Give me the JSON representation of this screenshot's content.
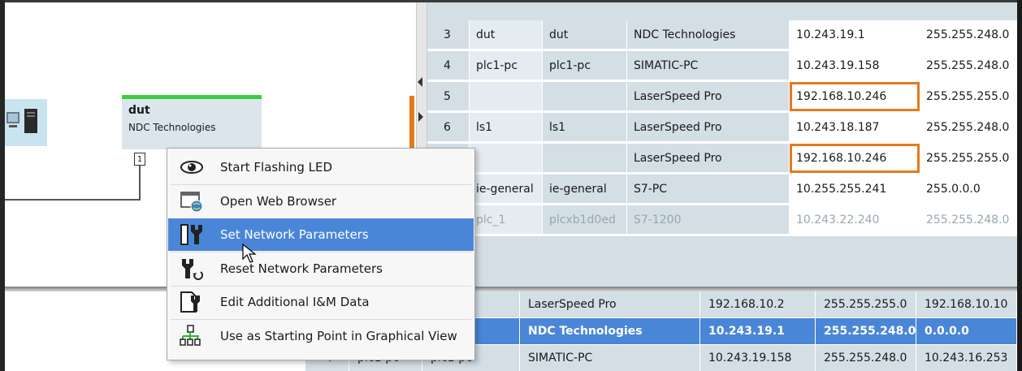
{
  "graph": {
    "device_name": "dut",
    "device_vendor": "NDC Technologies",
    "port_label": "1",
    "pc_icon": "pc-tower-icon",
    "colors": {
      "device_header": "#3dcc3d",
      "link_highlight": "#e57a1c"
    }
  },
  "top_table": {
    "rows": [
      {
        "num": "3",
        "name": "dut",
        "name2": "dut",
        "type": "NDC Technologies",
        "ip": "10.243.19.1",
        "mask": "255.255.248.0",
        "ip_highlight": false,
        "dim": false
      },
      {
        "num": "4",
        "name": "plc1-pc",
        "name2": "plc1-pc",
        "type": "SIMATIC-PC",
        "ip": "10.243.19.158",
        "mask": "255.255.248.0",
        "ip_highlight": false,
        "dim": false
      },
      {
        "num": "5",
        "name": "",
        "name2": "",
        "type": "LaserSpeed Pro",
        "ip": "192.168.10.246",
        "mask": "255.255.255.0",
        "ip_highlight": true,
        "dim": false
      },
      {
        "num": "6",
        "name": "ls1",
        "name2": "ls1",
        "type": "LaserSpeed Pro",
        "ip": "10.243.18.187",
        "mask": "255.255.248.0",
        "ip_highlight": false,
        "dim": false
      },
      {
        "num": "",
        "name": "",
        "name2": "",
        "type": "LaserSpeed Pro",
        "ip": "192.168.10.246",
        "mask": "255.255.255.0",
        "ip_highlight": true,
        "dim": false
      },
      {
        "num": "",
        "name": "ie-general",
        "name2": "ie-general",
        "type": "S7-PC",
        "ip": "10.255.255.241",
        "mask": "255.0.0.0",
        "ip_highlight": false,
        "dim": false
      },
      {
        "num": "",
        "name": "plc_1",
        "name2": "plcxb1d0ed",
        "type": "S7-1200",
        "ip": "10.243.22.240",
        "mask": "255.255.248.0",
        "ip_highlight": false,
        "dim": true
      }
    ]
  },
  "lower_table": {
    "rows": [
      {
        "num": "",
        "name": "",
        "name2": "",
        "type": "LaserSpeed Pro",
        "ip": "192.168.10.2",
        "mask": "255.255.255.0",
        "gateway": "192.168.10.10",
        "selected": false
      },
      {
        "num": "",
        "name": "",
        "name2": "",
        "type": "NDC Technologies",
        "ip": "10.243.19.1",
        "mask": "255.255.248.0",
        "gateway": "0.0.0.0",
        "selected": true
      },
      {
        "num": "4",
        "name": "plc1-pc",
        "name2": "plc1-pc",
        "type": "SIMATIC-PC",
        "ip": "10.243.19.158",
        "mask": "255.255.248.0",
        "gateway": "10.243.16.253",
        "selected": false
      }
    ]
  },
  "context_menu": {
    "items": [
      {
        "label": "Start Flashing LED",
        "icon": "eye-icon",
        "highlighted": false
      },
      {
        "label": "Open Web Browser",
        "icon": "web-browser-icon",
        "highlighted": false
      },
      {
        "label": "Set Network Parameters",
        "icon": "network-parameters-icon",
        "highlighted": true
      },
      {
        "label": "Reset Network Parameters",
        "icon": "reset-wrench-icon",
        "highlighted": false
      },
      {
        "label": "Edit Additional I&M Data",
        "icon": "edit-document-icon",
        "highlighted": false
      },
      {
        "label": "Use as Starting Point in Graphical View",
        "icon": "topology-icon",
        "highlighted": false
      }
    ],
    "highlight_color": "#4a86d8"
  }
}
